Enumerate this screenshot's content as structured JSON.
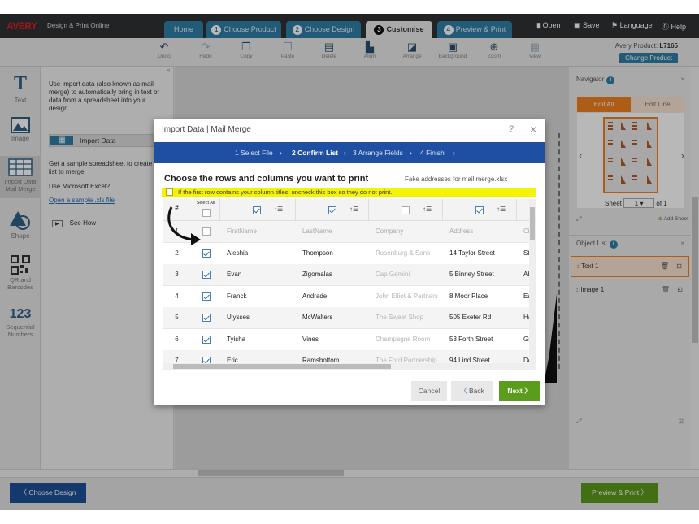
{
  "brand": {
    "logo": "AVERY",
    "site_title": "Design & Print Online"
  },
  "nav": {
    "home": "Home",
    "tabs": [
      {
        "num": "1",
        "label": "Choose Product"
      },
      {
        "num": "2",
        "label": "Choose Design"
      },
      {
        "num": "3",
        "label": "Customise"
      },
      {
        "num": "4",
        "label": "Preview & Print"
      }
    ],
    "open": "Open",
    "save": "Save",
    "language": "Language",
    "help": "Help"
  },
  "toolbar": {
    "items": [
      "Undo",
      "Redo",
      "Copy",
      "Paste",
      "Delete",
      "Align",
      "Arrange",
      "Background",
      "Zoom",
      "View"
    ],
    "product_prefix": "Avery Product:",
    "product_code": "L7165",
    "change_product": "Change Product"
  },
  "left_tools": {
    "text": "Text",
    "image": "Image",
    "import": "Import Data Mail Merge",
    "shape": "Shape",
    "qr": "QR and Barcodes",
    "seq_icon": "123",
    "seq": "Sequential Numbers"
  },
  "left_panel": {
    "close": "×",
    "intro": "Use import data (also known as mail merge) to automatically bring in text or data from a spreadsheet into your design.",
    "import_button": "Import Data",
    "sample_text": "Get a sample spreadsheet to create new list to merge",
    "excel_text": "Use Microsoft Excel?",
    "sample_link": "Open a sample .xls file",
    "see_how": "See How"
  },
  "right_panel": {
    "navigator_title": "Navigator",
    "edit_all": "Edit All",
    "edit_one": "Edit One",
    "sheet_label": "Sheet",
    "sheet_value": "1",
    "sheet_of": "of 1",
    "add_sheet": "Add Sheet",
    "object_list_title": "Object List",
    "objects": [
      "Text 1",
      "Image 1"
    ]
  },
  "modal": {
    "title": "Import Data | Mail Merge",
    "help": "?",
    "close": "×",
    "steps": [
      "1 Select File",
      "2 Confirm List",
      "3 Arrange Fields",
      "4 Finish"
    ],
    "heading": "Choose the rows and columns you want to print",
    "filename": "Fake addresses for mail merge.xlsx",
    "notice": "If the first row contains your column titles, uncheck this box so they do not print.",
    "col_hash": "#",
    "select_all": "Select All",
    "sort_icon": "↑☰",
    "columns": [
      {
        "checked": true
      },
      {
        "checked": true
      },
      {
        "checked": false
      },
      {
        "checked": true
      },
      {
        "checked": true
      }
    ],
    "rows": [
      {
        "num": "1",
        "checked": false,
        "cells": [
          "FirstName",
          "LastName",
          "Company",
          "Address",
          "Ci"
        ]
      },
      {
        "num": "2",
        "checked": true,
        "cells": [
          "Aleshia",
          "Thompson",
          "Rosenburg & Sons",
          "14 Taylor Street",
          "St"
        ]
      },
      {
        "num": "3",
        "checked": true,
        "cells": [
          "Evan",
          "Zigomalas",
          "Cap Gemini",
          "5 Binney Street",
          "Ab"
        ]
      },
      {
        "num": "4",
        "checked": true,
        "cells": [
          "Franck",
          "Andrade",
          "John Elliot & Partners",
          "8 Moor Place",
          "Ea"
        ]
      },
      {
        "num": "5",
        "checked": true,
        "cells": [
          "Ulysses",
          "McWalters",
          "The Sweet Shop",
          "505 Exeter Rd",
          "Ha"
        ]
      },
      {
        "num": "6",
        "checked": true,
        "cells": [
          "Tyisha",
          "Vines",
          "Champagne Room",
          "53 Forth Street",
          "Gr"
        ]
      },
      {
        "num": "7",
        "checked": true,
        "cells": [
          "Eric",
          "Ramsbottom",
          "The Ford Partnership",
          "94 Lind Street",
          "Dc"
        ]
      }
    ],
    "cancel": "Cancel",
    "back": "Back",
    "next": "Next"
  },
  "bottom": {
    "choose_design": "Choose Design",
    "preview_print": "Preview & Print"
  },
  "colors": {
    "topbar": "#2e3133",
    "tab": "#2f7fa7",
    "step_bar": "#1f4fa3",
    "notice": "#f4f400",
    "orange": "#f0821e",
    "next_green": "#5a9c1c"
  }
}
